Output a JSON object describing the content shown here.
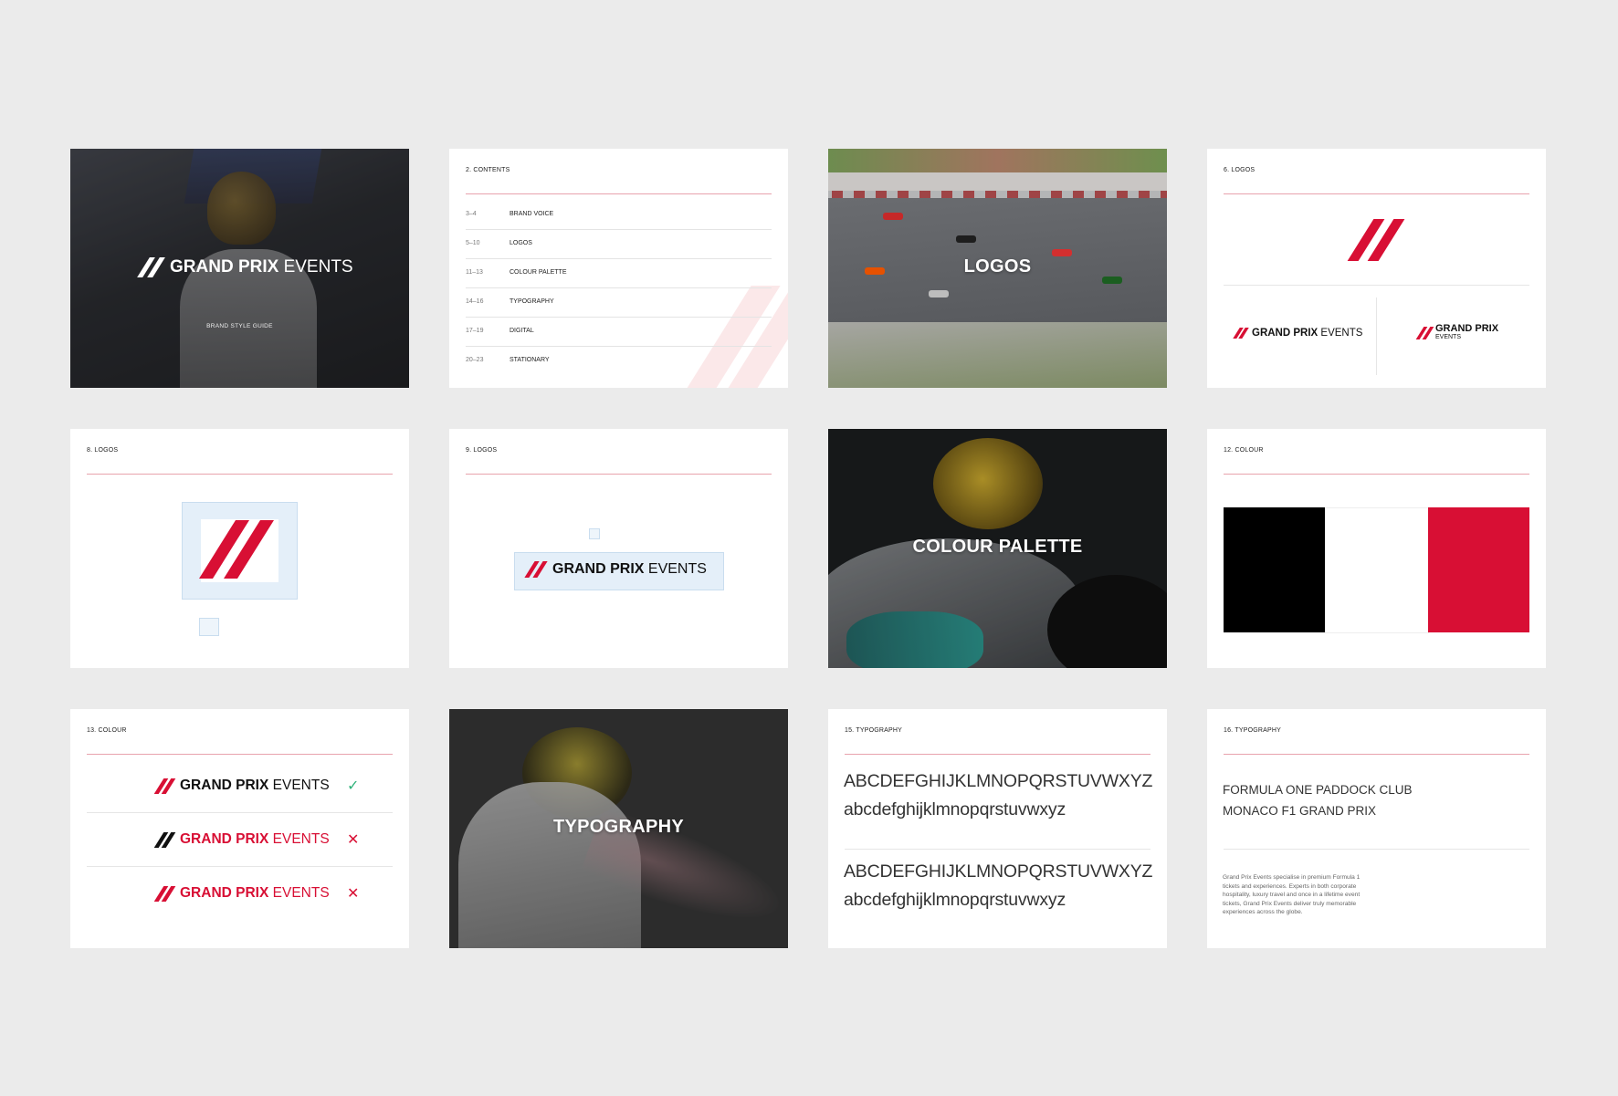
{
  "brand": {
    "bold": "GRAND PRIX",
    "light": "EVENTS",
    "red": "#d80f34",
    "style_guide_label": "BRAND STYLE GUIDE"
  },
  "slide_cover": {
    "title_bold": "GRAND PRIX",
    "title_light": "EVENTS",
    "subtitle": "BRAND STYLE GUIDE"
  },
  "slide_contents": {
    "header": "2. CONTENTS",
    "items": [
      {
        "pages": "3–4",
        "name": "BRAND VOICE"
      },
      {
        "pages": "5–10",
        "name": "LOGOS"
      },
      {
        "pages": "11–13",
        "name": "COLOUR PALETTE"
      },
      {
        "pages": "14–16",
        "name": "TYPOGRAPHY"
      },
      {
        "pages": "17–19",
        "name": "DIGITAL"
      },
      {
        "pages": "20–23",
        "name": "STATIONARY"
      }
    ]
  },
  "slide_logos_cover": {
    "title": "LOGOS"
  },
  "slide_logos6": {
    "header": "6. LOGOS",
    "stacked_bold": "GRAND PRIX",
    "stacked_light": "EVENTS"
  },
  "slide_logos8": {
    "header": "8. LOGOS"
  },
  "slide_logos9": {
    "header": "9. LOGOS"
  },
  "slide_colour_cover": {
    "title": "COLOUR PALETTE"
  },
  "slide_colour12": {
    "header": "12. COLOUR",
    "swatches": [
      {
        "color": "#000000"
      },
      {
        "color": "#ffffff"
      },
      {
        "color": "#d80f34"
      }
    ]
  },
  "slide_colour13": {
    "header": "13. COLOUR",
    "marks": {
      "ok": "✓",
      "no": "✕"
    },
    "ok_color": "#2fb27a"
  },
  "slide_typo_cover": {
    "title": "TYPOGRAPHY"
  },
  "slide_typo15": {
    "header": "15. TYPOGRAPHY",
    "upper_1": "ABCDEFGHIJKLMNOPQRSTUVWXYZ",
    "lower_1": "abcdefghijklmnopqrstuvwxyz",
    "upper_2": "ABCDEFGHIJKLMNOPQRSTUVWXYZ",
    "lower_2": "abcdefghijklmnopqrstuvwxyz"
  },
  "slide_typo16": {
    "header": "16. TYPOGRAPHY",
    "headline_1": "FORMULA ONE PADDOCK CLUB",
    "headline_2": "MONACO F1 GRAND PRIX",
    "body": "Grand Prix Events specialise in premium Formula 1 tickets and experiences. Experts in both corporate hospitality, luxury travel and once in a lifetime event tickets, Grand Prix Events deliver truly memorable experiences across the globe."
  }
}
